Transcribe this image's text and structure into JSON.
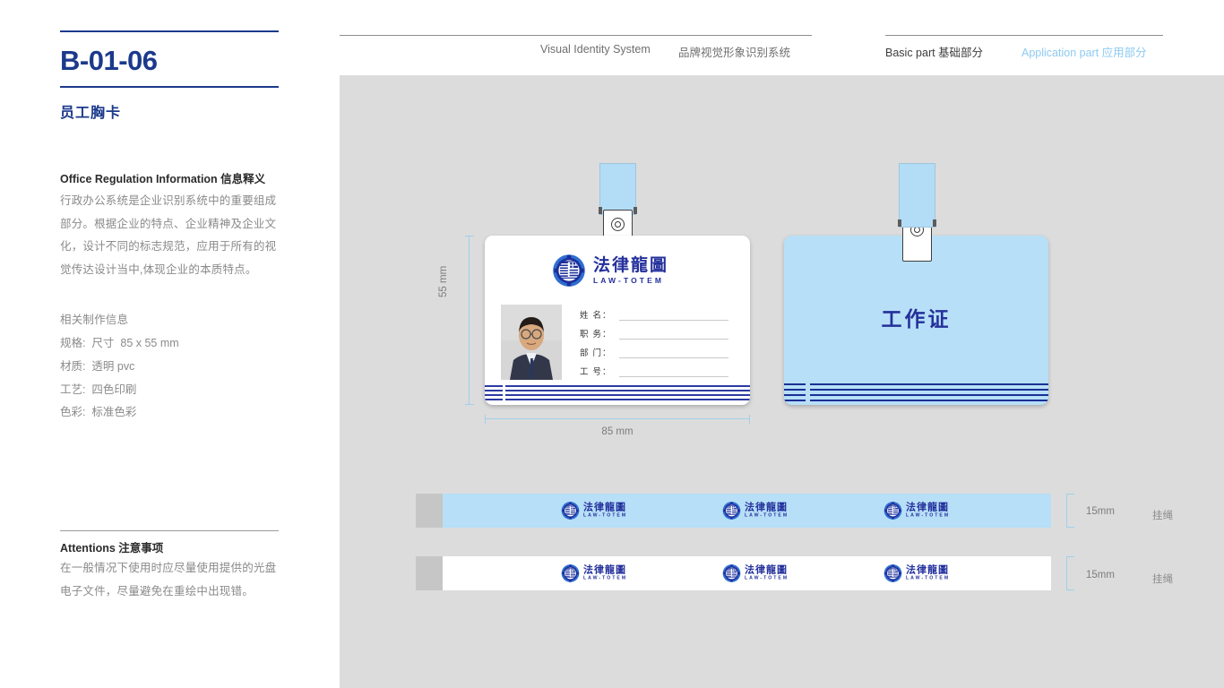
{
  "left": {
    "code": "B-01-06",
    "subtitle": "员工胸卡",
    "section_heading": "Office Regulation Information  信息释义",
    "body_paragraph": "行政办公系统是企业识别系统中的重要组成部分。根据企业的特点、企业精神及企业文化，设计不同的标志规范，应用于所有的视觉传达设计当中,体现企业的本质特点。",
    "spec_heading": "相关制作信息",
    "specs": [
      "规格:  尺寸  85 x 55 mm",
      "材质:  透明 pvc",
      "工艺:  四色印刷",
      "色彩:  标准色彩"
    ],
    "attentions_heading": "Attentions 注意事项",
    "attentions_body": "在一般情况下使用时应尽量使用提供的光盘电子文件，尽量避免在重绘中出现错。"
  },
  "header": {
    "vis_en": "Visual Identity System",
    "vis_cn": "品牌视觉形象识别系统",
    "basic": "Basic part  基础部分",
    "application": "Application part  应用部分"
  },
  "card_front": {
    "logo_cn": "法律龍圖",
    "logo_en": "LAW-TOTEM",
    "fields": [
      {
        "label": "姓 名："
      },
      {
        "label": "职 务："
      },
      {
        "label": "部 门："
      },
      {
        "label": "工 号："
      }
    ]
  },
  "card_back": {
    "title": "工作证"
  },
  "dimensions": {
    "height": "55 mm",
    "width": "85 mm"
  },
  "lanyards": [
    {
      "variant": "blue",
      "size": "15mm",
      "note": "挂绳"
    },
    {
      "variant": "white",
      "size": "15mm",
      "note": "挂绳"
    }
  ],
  "colors": {
    "brand_blue": "#1b3a8c",
    "logo_blue": "#23309c",
    "light_blue": "#b7dff7",
    "canvas_gray": "#dcdcdc",
    "accent_cyan": "#8ecaf0"
  }
}
